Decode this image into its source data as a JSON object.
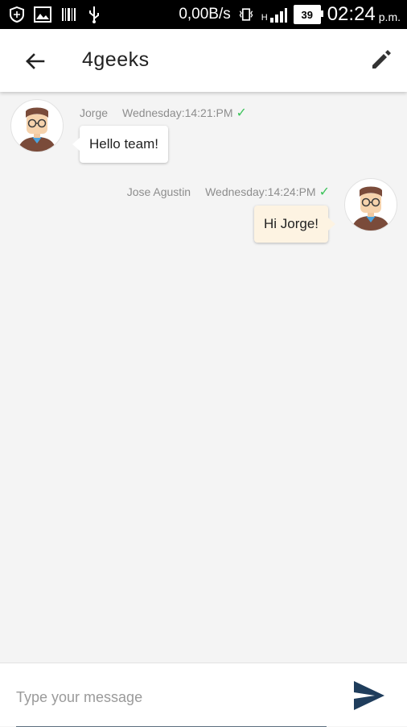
{
  "status_bar": {
    "speed": "0,00B/s",
    "network": "H",
    "battery": "39",
    "time": "02:24",
    "ampm": "p.m."
  },
  "header": {
    "title": "4geeks",
    "back_icon": "arrow-back-icon",
    "edit_icon": "pencil-icon"
  },
  "messages": [
    {
      "sender": "Jorge",
      "timestamp": "Wednesday:14:21:PM",
      "text": "Hello team!",
      "direction": "incoming",
      "status": "sent"
    },
    {
      "sender": "Jose Agustin",
      "timestamp": "Wednesday:14:24:PM",
      "text": "Hi Jorge!",
      "direction": "outgoing",
      "status": "sent"
    }
  ],
  "composer": {
    "placeholder": "Type your message",
    "value": "",
    "send_icon": "send-icon"
  },
  "colors": {
    "accent_check": "#3cc35a",
    "outgoing_bubble": "#fdf3e2",
    "send_button": "#1f3d5c"
  }
}
